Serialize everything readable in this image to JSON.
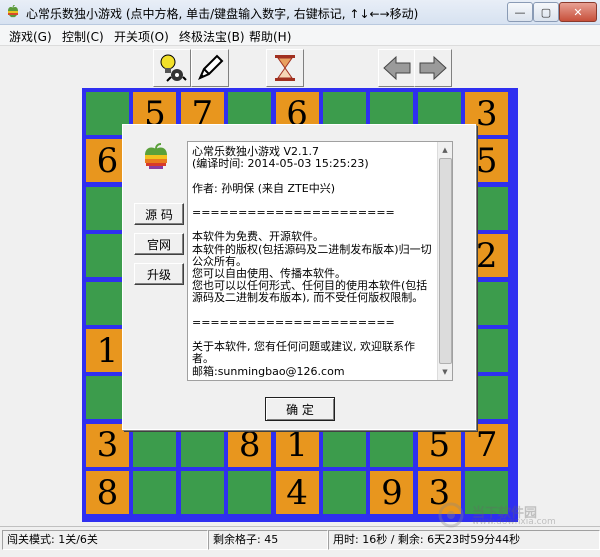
{
  "window": {
    "title": "心常乐数独小游戏    (点中方格, 单击/键盘输入数字, 右键标记, ↑↓←→移动)"
  },
  "menu": [
    "游戏(G)",
    "控制(C)",
    "开关项(O)",
    "终极法宝(B)",
    "帮助(H)"
  ],
  "toolbar": {
    "icons": [
      "bulb-gear-icon",
      "pencil-icon",
      "hourglass-icon",
      "arrow-left-icon",
      "arrow-right-icon"
    ]
  },
  "board": {
    "cells": [
      [
        "",
        "5",
        "7",
        "",
        "6",
        "",
        "",
        "",
        "3"
      ],
      [
        "6",
        "",
        "",
        "",
        "",
        "",
        "",
        "",
        "5"
      ],
      [
        "",
        "",
        "",
        "",
        "",
        "",
        "",
        "",
        ""
      ],
      [
        "",
        "",
        "",
        "",
        "",
        "",
        "",
        "",
        "2"
      ],
      [
        "",
        "",
        "",
        "",
        "",
        "",
        "",
        "",
        ""
      ],
      [
        "1",
        "",
        "",
        "",
        "",
        "",
        "",
        "",
        ""
      ],
      [
        "",
        "",
        "",
        "",
        "",
        "",
        "",
        "",
        ""
      ],
      [
        "3",
        "",
        "",
        "8",
        "1",
        "",
        "",
        "5",
        "7"
      ],
      [
        "8",
        "",
        "",
        "",
        "4",
        "",
        "9",
        "3",
        ""
      ]
    ],
    "given_color": "#e8961e",
    "empty_color": "#3c9c4c",
    "border_color": "#2f2ff0"
  },
  "dialog": {
    "buttons": [
      "源 码",
      "官网",
      "升级"
    ],
    "lines": [
      "心常乐数独小游戏    V2.1.7",
      "(编译时间: 2014-05-03 15:25:23)",
      "",
      "作者: 孙明保 (来自 ZTE中兴)",
      "",
      "======================",
      "",
      "本软件为免费、开源软件。",
      "本软件的版权(包括源码及二进制发布版本)归一切",
      "公众所有。",
      "您可以自由使用、传播本软件。",
      "您也可以以任何形式、任何目的使用本软件(包括",
      "源码及二进制发布版本), 而不受任何版权限制。",
      "",
      "======================",
      "",
      "关于本软件, 您有任何问题或建议, 欢迎联系作",
      "者。",
      "邮箱:sunmingbao@126.com"
    ],
    "ok_label": "确 定"
  },
  "status": {
    "mode": "闯关模式: 1关/6关",
    "remaining": "剩余格子: 45",
    "time": "用时: 16秒 / 剩余: 6天23时59分44秒"
  },
  "watermark": {
    "line1": "当下软件园",
    "line2": "www.downxia.com"
  }
}
